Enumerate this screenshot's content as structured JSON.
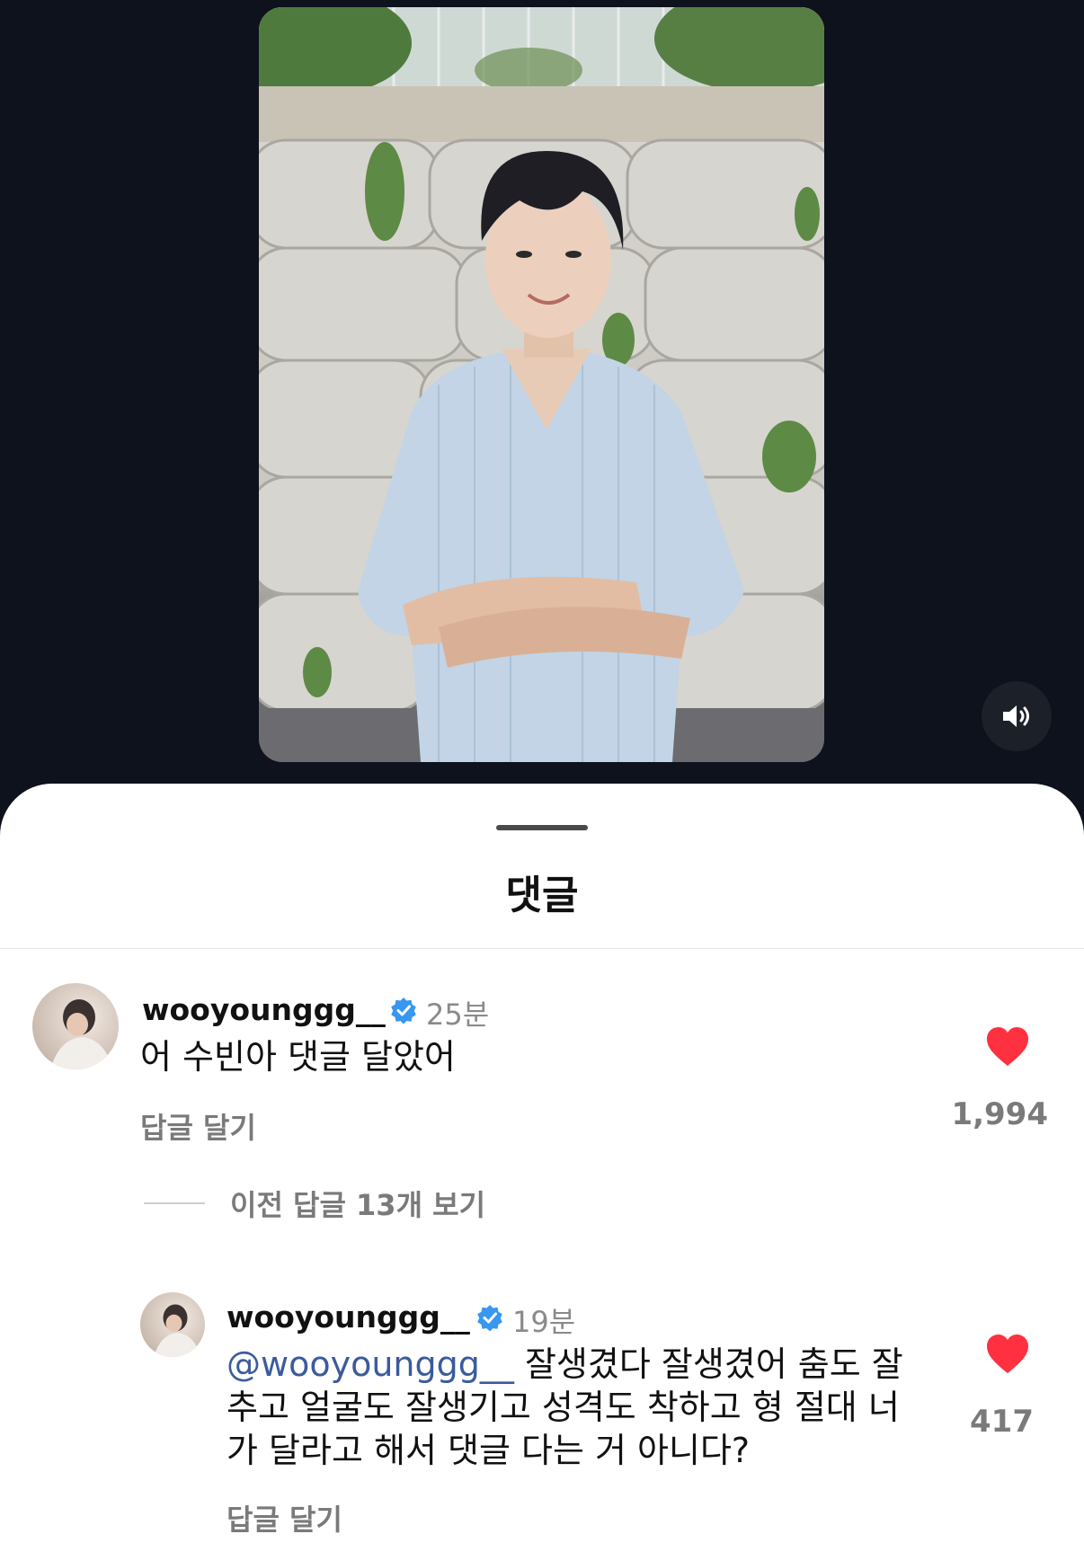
{
  "sheet": {
    "title": "댓글"
  },
  "comments": [
    {
      "username": "wooyounggg__",
      "time": "25분",
      "text": "어 수빈아 댓글 달았어",
      "reply_label": "답글 달기",
      "likes": "1,994"
    }
  ],
  "view_previous": "이전 답글 13개 보기",
  "reply": {
    "username": "wooyounggg__",
    "time": "19분",
    "mention": "@wooyounggg__",
    "text_line1": " 잘생겼다 잘생겼어 춤도 잘",
    "text_line2": "추고 얼굴도 잘생기고 성격도 착하고 형 절대 너",
    "text_line3": "가 달라고 해서 댓글 다는 거 아니다?",
    "reply_label": "답글 달기",
    "likes": "417"
  },
  "colors": {
    "heart": "#ff3040",
    "verified": "#3897f0",
    "mention": "#3b5b9d",
    "background": "#0e121c"
  },
  "icons": [
    "volume-icon",
    "heart-icon",
    "verified-badge-icon"
  ]
}
